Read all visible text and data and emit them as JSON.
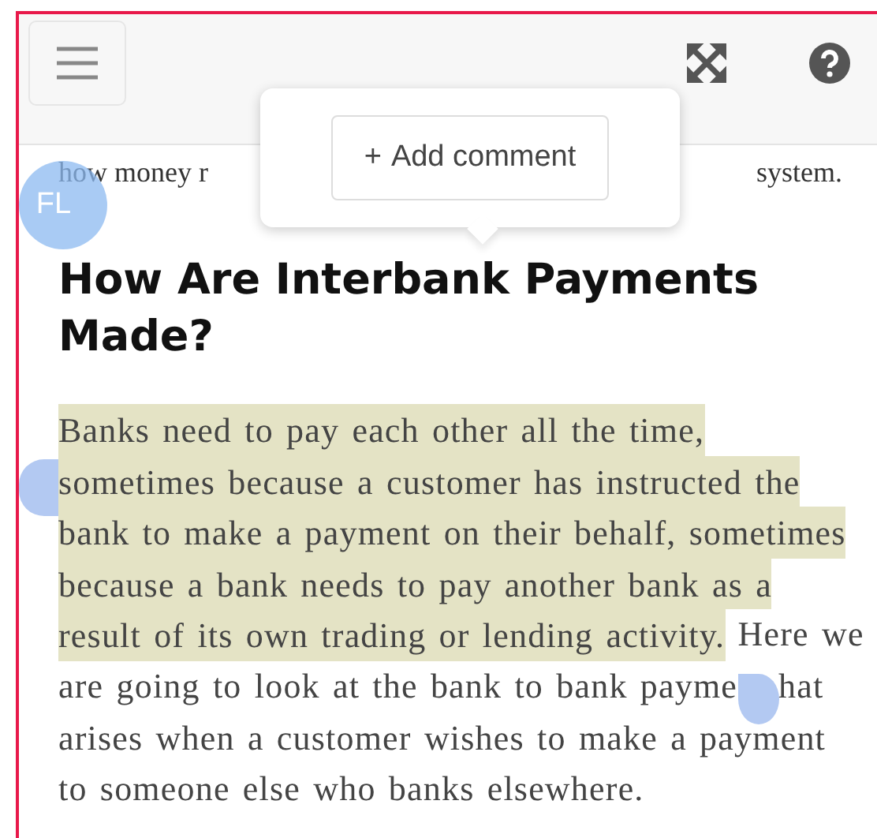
{
  "popup": {
    "button": {
      "icon": "+",
      "label": "Add comment"
    }
  },
  "intro_line": {
    "left": "how money r",
    "right": "system."
  },
  "avatar": {
    "initials": "FL"
  },
  "heading": "How Are Interbank Payments Made?",
  "paragraph_lines": [
    [
      {
        "text": "Banks need to pay each other all the time,",
        "highlighted": true
      }
    ],
    [
      {
        "text": "sometimes because a customer has instructed the",
        "highlighted": true
      }
    ],
    [
      {
        "text": "bank to make a payment on their behalf, sometimes",
        "highlighted": true
      }
    ],
    [
      {
        "text": "because a bank needs to pay another bank as a",
        "highlighted": true
      }
    ],
    [
      {
        "text": "result of its own trading or lending activity.",
        "highlighted": true
      },
      {
        "text": " Here we",
        "highlighted": false
      }
    ],
    [
      {
        "text": "are going to look at the bank to bank payme",
        "highlighted": false
      },
      {
        "kind": "handle"
      },
      {
        "text": "hat",
        "highlighted": false
      }
    ],
    [
      {
        "text": "arises when a customer wishes to make a payment",
        "highlighted": false
      }
    ],
    [
      {
        "text": "to someone else who banks elsewhere.",
        "highlighted": false
      }
    ]
  ]
}
